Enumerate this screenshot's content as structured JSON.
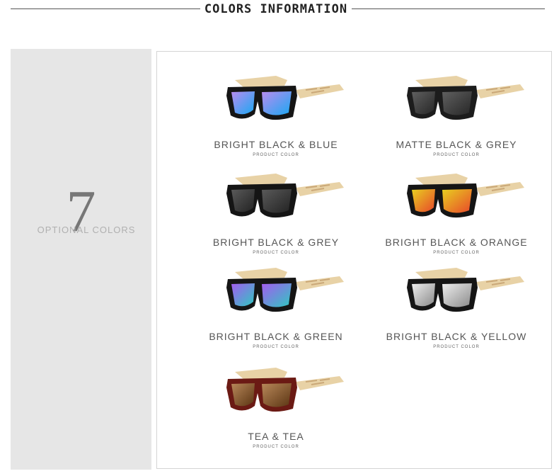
{
  "header": {
    "title": "COLORS INFORMATION"
  },
  "sidebar": {
    "number": "7",
    "label": "OPTIONAL COLORS"
  },
  "products": [
    {
      "name": "BRIGHT BLACK & BLUE",
      "sub": "PRODUCT COLOR",
      "frame": "#151515",
      "lensA": "#b98cf0",
      "lensB": "#1aa8f2"
    },
    {
      "name": "MATTE BLACK & GREY",
      "sub": "PRODUCT COLOR",
      "frame": "#1c1c1c",
      "lensA": "#606060",
      "lensB": "#262626"
    },
    {
      "name": "BRIGHT BLACK & GREY",
      "sub": "PRODUCT COLOR",
      "frame": "#151515",
      "lensA": "#5a5a5a",
      "lensB": "#222222"
    },
    {
      "name": "BRIGHT BLACK & ORANGE",
      "sub": "PRODUCT COLOR",
      "frame": "#151515",
      "lensA": "#e8d020",
      "lensB": "#e8482a"
    },
    {
      "name": "BRIGHT BLACK & GREEN",
      "sub": "PRODUCT COLOR",
      "frame": "#151515",
      "lensA": "#a45cf0",
      "lensB": "#2ec8c0"
    },
    {
      "name": "BRIGHT BLACK & YELLOW",
      "sub": "PRODUCT COLOR",
      "frame": "#151515",
      "lensA": "#eeeeee",
      "lensB": "#8a8a8a"
    },
    {
      "name": "TEA & TEA",
      "sub": "PRODUCT COLOR",
      "frame": "#6b1a14",
      "lensA": "#b8885a",
      "lensB": "#5a3412"
    }
  ],
  "colors": {
    "temple": "#e8d2a6",
    "temple_stripe": "#caa878"
  }
}
